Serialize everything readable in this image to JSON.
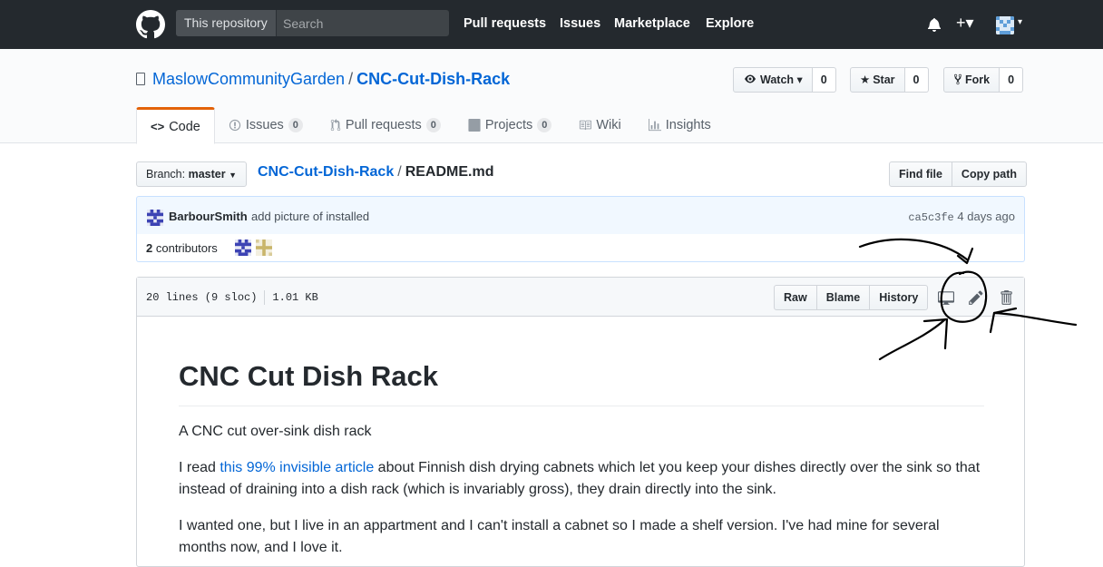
{
  "header": {
    "scope_label": "This repository",
    "search_placeholder": "Search",
    "nav": [
      "Pull requests",
      "Issues",
      "Marketplace",
      "Explore"
    ],
    "plus_label": "+▾",
    "avatar_caret": "▾"
  },
  "repo": {
    "owner": "MaslowCommunityGarden",
    "separator": "/",
    "name": "CNC-Cut-Dish-Rack",
    "watch_label": "Watch ▾",
    "watch_count": "0",
    "star_label": "Star",
    "star_count": "0",
    "fork_label": "Fork",
    "fork_count": "0"
  },
  "tabs": [
    {
      "label": "Code",
      "icon": "<>"
    },
    {
      "label": "Issues",
      "count": "0"
    },
    {
      "label": "Pull requests",
      "count": "0"
    },
    {
      "label": "Projects",
      "count": "0"
    },
    {
      "label": "Wiki"
    },
    {
      "label": "Insights"
    }
  ],
  "file_nav": {
    "branch_prefix": "Branch:",
    "branch": "master",
    "repo_crumb": "CNC-Cut-Dish-Rack",
    "slash": "/",
    "file": "README.md",
    "find_file": "Find file",
    "copy_path": "Copy path"
  },
  "commit": {
    "author": "BarbourSmith",
    "message": "add picture of installed",
    "sha": "ca5c3fe",
    "age": "4 days ago",
    "contributors_count": "2",
    "contributors_label": "contributors"
  },
  "file": {
    "lines": "20 lines (9 sloc)",
    "size": "1.01 KB",
    "raw": "Raw",
    "blame": "Blame",
    "history": "History"
  },
  "readme": {
    "title": "CNC Cut Dish Rack",
    "p1": "A CNC cut over-sink dish rack",
    "p2_before": "I read ",
    "p2_link": "this 99% invisible article",
    "p2_after": " about Finnish dish drying cabnets which let you keep your dishes directly over the sink so that instead of draining into a dish rack (which is invariably gross), they drain directly into the sink.",
    "p3": "I wanted one, but I live in an appartment and I can't install a cabnet so I made a shelf version. I've had mine for several months now, and I love it."
  },
  "colors": {
    "header_bg": "#24292e",
    "link": "#0366d6",
    "tab_accent": "#e36209",
    "commit_bg": "#f1f8ff"
  }
}
